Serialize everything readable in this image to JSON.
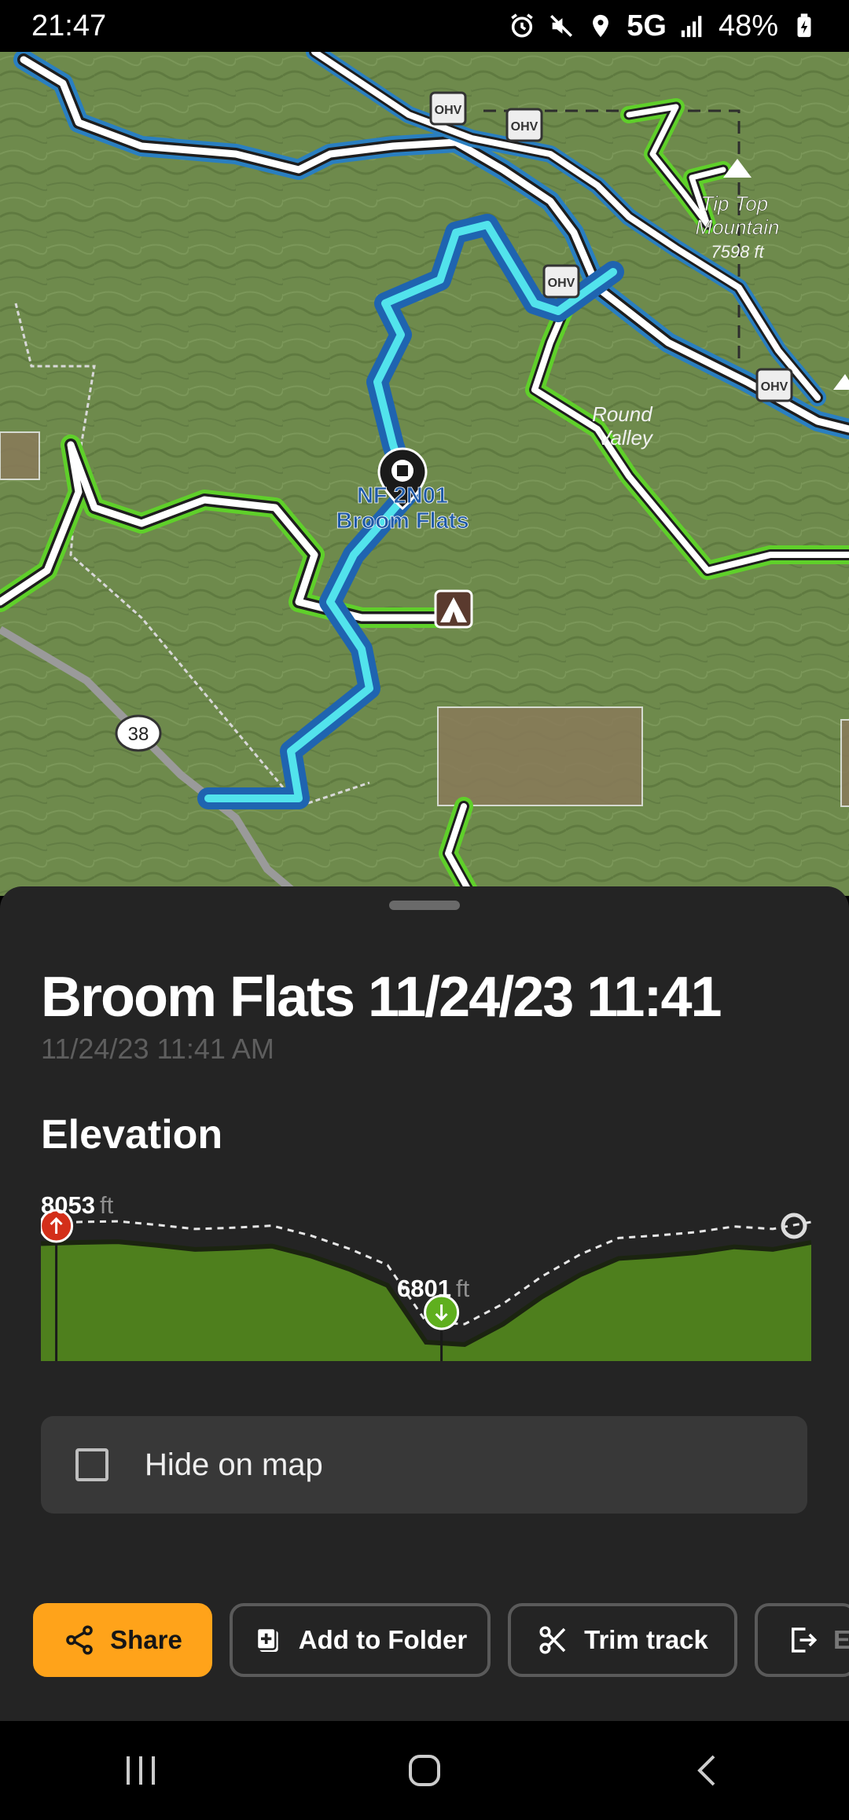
{
  "status_bar": {
    "time": "21:47",
    "network": "5G",
    "battery": "48%",
    "icons": [
      "alarm-icon",
      "mute-icon",
      "location-icon",
      "signal-icon",
      "battery-icon"
    ]
  },
  "map": {
    "labels": {
      "peak_name": "Tip Top Mountain",
      "peak_elevation": "7598 ft",
      "round_valley": "Round Valley",
      "waypoint_code": "NF 2N01",
      "waypoint_name": "Broom Flats",
      "highway": "38",
      "ohv": "OHV"
    }
  },
  "track": {
    "title": "Broom Flats 11/24/23 11:41",
    "subtitle": "11/24/23 11:41 AM"
  },
  "elevation": {
    "heading": "Elevation",
    "max_value": "8053",
    "min_value": "6801",
    "unit": "ft"
  },
  "chart_data": {
    "type": "area",
    "title": "Elevation",
    "xlabel": "",
    "ylabel": "",
    "annotations": [
      {
        "label": "8053 ft",
        "kind": "max",
        "position_fraction": 0.02
      },
      {
        "label": "6801 ft",
        "kind": "min",
        "position_fraction": 0.52
      }
    ],
    "x": [
      0.0,
      0.05,
      0.1,
      0.15,
      0.2,
      0.25,
      0.3,
      0.35,
      0.4,
      0.45,
      0.5,
      0.55,
      0.6,
      0.65,
      0.7,
      0.75,
      0.8,
      0.85,
      0.9,
      0.95,
      1.0
    ],
    "y": [
      8030,
      8045,
      8053,
      8010,
      7960,
      7975,
      8000,
      7880,
      7720,
      7520,
      6830,
      6801,
      7050,
      7380,
      7650,
      7850,
      7880,
      7920,
      7990,
      7960,
      8045
    ],
    "ylim": [
      6600,
      8150
    ],
    "colors": {
      "fill": "#4e7f1d",
      "line": "#1b2410",
      "marker_max": "#d32f1a",
      "marker_min": "#5faf1e"
    }
  },
  "hide_on_map": {
    "label": "Hide on map",
    "checked": false
  },
  "actions": {
    "share": "Share",
    "add_to_folder": "Add to Folder",
    "trim_track": "Trim track",
    "export": "E"
  },
  "accent_color": "#ffa31a"
}
